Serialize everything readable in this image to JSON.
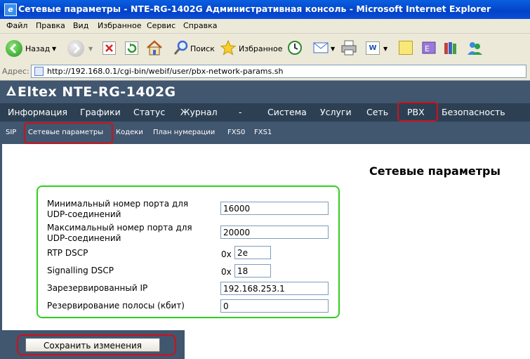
{
  "window": {
    "title": "Сетевые параметры - NTE-RG-1402G Административная консоль - Microsoft Internet Explorer"
  },
  "menubar": {
    "items": [
      "Файл",
      "Правка",
      "Вид",
      "Избранное",
      "Сервис",
      "Справка"
    ]
  },
  "toolbar": {
    "back_label": "Назад",
    "search_label": "Поиск",
    "favorites_label": "Избранное"
  },
  "addressbar": {
    "label": "Адрес:",
    "url": "http://192.168.0.1/cgi-bin/webif/user/pbx-network-params.sh"
  },
  "brand": {
    "name": "Eltex NTE-RG-1402G"
  },
  "mainnav": {
    "items": [
      "Информация",
      "Графики",
      "Статус",
      "Журнал",
      "-",
      "Система",
      "Услуги",
      "Сеть",
      "PBX",
      "Безопасность"
    ],
    "active": "PBX"
  },
  "subnav": {
    "items": [
      "SIP",
      "Сетевые параметры",
      "Кодеки",
      "План нумерации",
      "FXS0",
      "FXS1"
    ],
    "active": "Сетевые параметры"
  },
  "page": {
    "title": "Сетевые параметры"
  },
  "form": {
    "min_port_label_1": "Минимальный номер порта для",
    "min_port_label_2": "UDP-соединений",
    "min_port_value": "16000",
    "max_port_label_1": "Максимальный номер порта для",
    "max_port_label_2": "UDP-соединений",
    "max_port_value": "20000",
    "rtp_dscp_label": "RTP DSCP",
    "rtp_dscp_prefix": "0x",
    "rtp_dscp_value": "2e",
    "sig_dscp_label": "Signalling DSCP",
    "sig_dscp_prefix": "0x",
    "sig_dscp_value": "18",
    "reserved_ip_label": "Зарезервированный IP",
    "reserved_ip_value": "192.168.253.1",
    "bandwidth_label": "Резервирование полосы (кбит)",
    "bandwidth_value": "0"
  },
  "footer": {
    "save_label": "Сохранить изменения"
  },
  "colors": {
    "header_bg": "#41566f",
    "nav_bg": "#2d4053",
    "highlight_red": "#d0101a",
    "highlight_green": "#2fcf1f"
  }
}
